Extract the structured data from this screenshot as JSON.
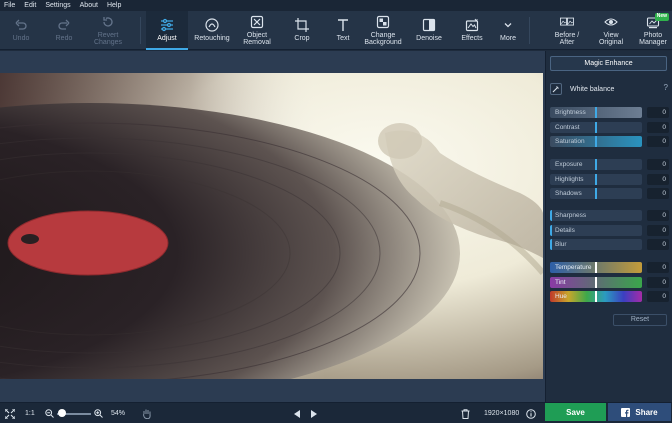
{
  "menu": [
    "File",
    "Edit",
    "Settings",
    "About",
    "Help"
  ],
  "toolbar": {
    "undo": "Undo",
    "redo": "Redo",
    "revert": [
      "Revert",
      "Changes"
    ],
    "adjust": "Adjust",
    "retouching": "Retouching",
    "object_removal": [
      "Object",
      "Removal"
    ],
    "crop": "Crop",
    "text": "Text",
    "change_background": [
      "Change",
      "Background"
    ],
    "denoise": "Denoise",
    "effects": "Effects",
    "more": "More",
    "before_after": [
      "Before /",
      "After"
    ],
    "view_original": [
      "View",
      "Original"
    ],
    "photo_manager": [
      "Photo",
      "Manager"
    ],
    "new_badge": "New"
  },
  "panel": {
    "magic_enhance": "Magic Enhance",
    "white_balance": "White balance",
    "help": "?",
    "sliders": [
      {
        "label": "Brightness",
        "value": "0"
      },
      {
        "label": "Contrast",
        "value": "0"
      },
      {
        "label": "Saturation",
        "value": "0"
      },
      {
        "label": "Exposure",
        "value": "0"
      },
      {
        "label": "Highlights",
        "value": "0"
      },
      {
        "label": "Shadows",
        "value": "0"
      },
      {
        "label": "Sharpness",
        "value": "0"
      },
      {
        "label": "Details",
        "value": "0"
      },
      {
        "label": "Blur",
        "value": "0"
      },
      {
        "label": "Temperature",
        "value": "0"
      },
      {
        "label": "Tint",
        "value": "0"
      },
      {
        "label": "Hue",
        "value": "0"
      }
    ],
    "reset": "Reset"
  },
  "bottom": {
    "ratio": "1:1",
    "zoom": "54%",
    "resolution": "1920×1080",
    "save": "Save",
    "share": "Share"
  },
  "colors": {
    "accent": "#3fa9e6",
    "save": "#1f9d55",
    "share": "#2e4d7a"
  }
}
